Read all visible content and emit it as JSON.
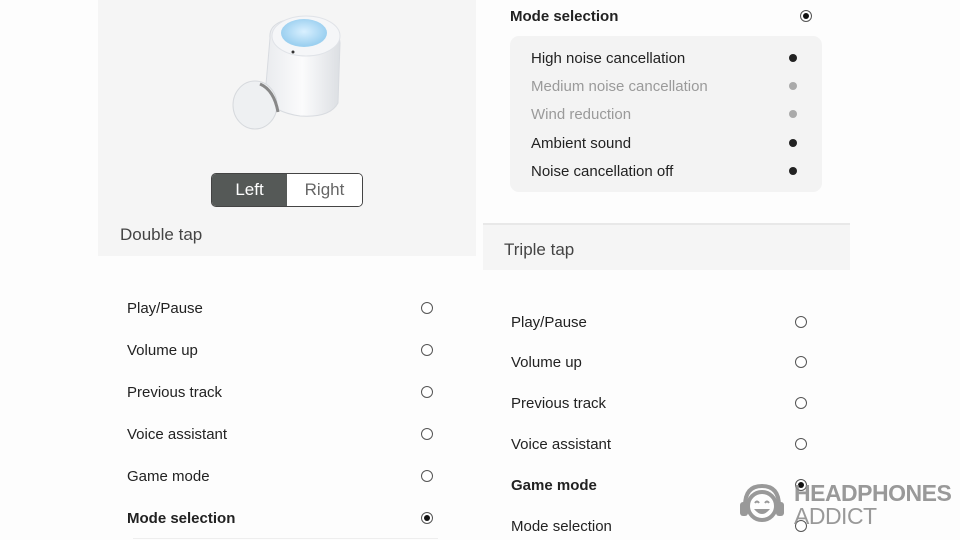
{
  "left_screen": {
    "earbud_image": "earbud-product-image",
    "side_toggle": {
      "options": [
        "Left",
        "Right"
      ],
      "selected": "Left"
    },
    "section_title": "Double tap",
    "options": [
      {
        "label": "Play/Pause",
        "selected": false
      },
      {
        "label": "Volume up",
        "selected": false
      },
      {
        "label": "Previous track",
        "selected": false
      },
      {
        "label": "Voice assistant",
        "selected": false
      },
      {
        "label": "Game mode",
        "selected": false
      },
      {
        "label": "Mode selection",
        "selected": true
      }
    ]
  },
  "right_screen": {
    "mode_selection": {
      "label": "Mode selection",
      "selected": true,
      "modes": [
        {
          "label": "High noise cancellation",
          "enabled": true
        },
        {
          "label": "Medium noise cancellation",
          "enabled": false
        },
        {
          "label": "Wind reduction",
          "enabled": false
        },
        {
          "label": "Ambient sound",
          "enabled": true
        },
        {
          "label": "Noise cancellation off",
          "enabled": true
        }
      ]
    },
    "section_title": "Triple tap",
    "options": [
      {
        "label": "Play/Pause",
        "selected": false
      },
      {
        "label": "Volume up",
        "selected": false
      },
      {
        "label": "Previous track",
        "selected": false
      },
      {
        "label": "Voice assistant",
        "selected": false
      },
      {
        "label": "Game mode",
        "selected": true
      },
      {
        "label": "Mode selection",
        "selected": false
      }
    ]
  },
  "watermark": {
    "line1": "HEADPHONES",
    "line2": "ADDICT",
    "icon": "smiling-headphones-face-icon"
  },
  "colors": {
    "toggle_active_bg": "#555957",
    "panel_bg": "#f5f5f5",
    "mode_card_bg": "#f3f3f3",
    "disabled_text": "#9a9a9a"
  }
}
